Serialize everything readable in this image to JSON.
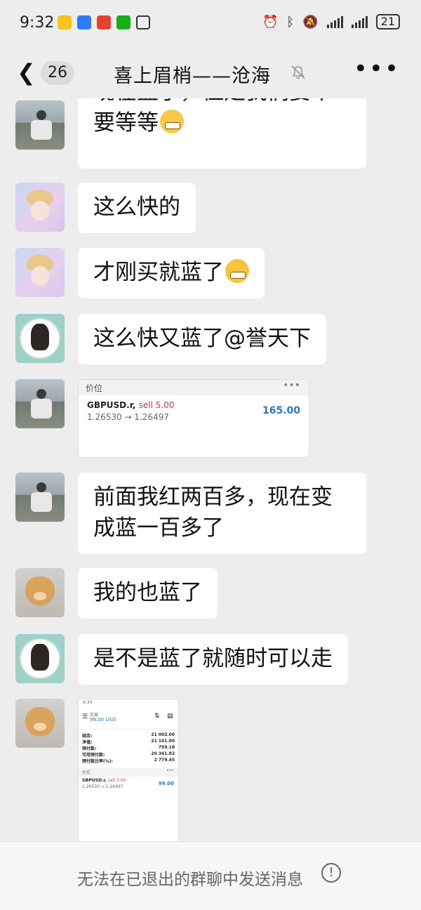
{
  "status": {
    "time": "9:32",
    "battery": "21"
  },
  "header": {
    "unread_count": "26",
    "title": "喜上眉梢——沧海",
    "more": "•••"
  },
  "messages": [
    {
      "type": "text",
      "text": "现在蓝了，但是我们要不要等等",
      "emoji": "grinning-emoji"
    },
    {
      "type": "text",
      "text": "这么快的"
    },
    {
      "type": "text",
      "text": "才刚买就蓝了",
      "emoji": "crying-laughing-emoji"
    },
    {
      "type": "text",
      "text": "这么快又蓝了@誉天下"
    },
    {
      "type": "card",
      "head": "价位",
      "dots": "•••",
      "symbol": "GBPUSD.r,",
      "side": "sell 5.00",
      "prices": "1.26530 → 1.26497",
      "value": "165.00"
    },
    {
      "type": "text",
      "text": "前面我红两百多，现在变成蓝一百多了"
    },
    {
      "type": "text",
      "text": "我的也蓝了"
    },
    {
      "type": "text",
      "text": "是不是蓝了就随时可以走"
    },
    {
      "type": "image",
      "shot_time": "6:34",
      "label": "交易",
      "amount": "99.00 USD",
      "rows": [
        {
          "k": "结余:",
          "v": "21 002.00"
        },
        {
          "k": "净值:",
          "v": "21 101.00"
        },
        {
          "k": "预付款:",
          "v": "759.18"
        },
        {
          "k": "可用预付款:",
          "v": "20 341.82"
        },
        {
          "k": "预付款比率(%):",
          "v": "2 779.45"
        }
      ],
      "section": "价位",
      "symbol": "GBPUSD.r,",
      "side": "sell 3.00",
      "prices": "1.26530 → 1.26497",
      "value": "99.00"
    }
  ],
  "footer": {
    "text": "无法在已退出的群聊中发送消息",
    "icon": "!"
  }
}
